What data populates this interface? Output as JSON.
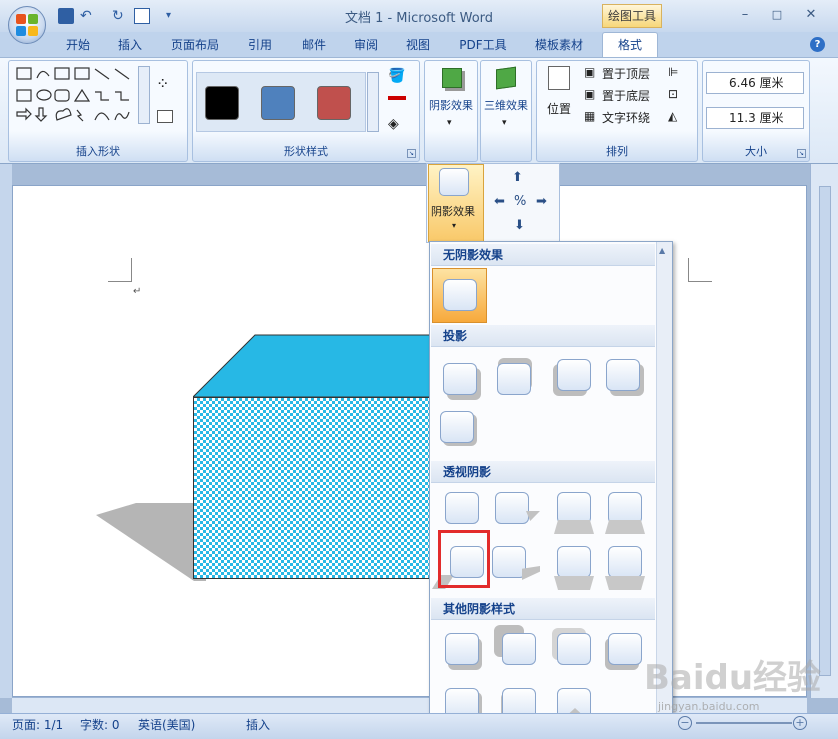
{
  "window": {
    "title": "文档 1 - Microsoft Word",
    "context_tab_group": "绘图工具",
    "min": "–",
    "max": "□",
    "close": "✕"
  },
  "tabs": [
    "开始",
    "插入",
    "页面布局",
    "引用",
    "邮件",
    "审阅",
    "视图",
    "PDF工具",
    "模板素材",
    "格式"
  ],
  "ribbon": {
    "groups": {
      "insert_shapes": "插入形状",
      "shape_styles": "形状样式",
      "shadow_effects": "阴影效果",
      "three_d": "三维效果",
      "arrange": "排列",
      "size": "大小"
    },
    "arrange": {
      "position": "位置",
      "bring_front": "置于顶层",
      "send_back": "置于底层",
      "text_wrap": "文字环绕"
    },
    "size": {
      "height": "6.46 厘米",
      "width": "11.3 厘米"
    },
    "swatch_colors": [
      "#000000",
      "#4f81bd",
      "#c0504d"
    ]
  },
  "popup": {
    "shadow_button_label": "阴影效果"
  },
  "gallery": {
    "sections": [
      "无阴影效果",
      "投影",
      "透视阴影",
      "其他阴影样式"
    ]
  },
  "status": {
    "page": "页面: 1/1",
    "words": "字数: 0",
    "language": "英语(美国)",
    "mode": "插入"
  },
  "watermark": {
    "text": "Baidu经验",
    "sub": "jingyan.baidu.com"
  },
  "colors": {
    "accent": "#15428b",
    "shape_fill": "#27b8e5",
    "highlight": "#e22b2b"
  }
}
